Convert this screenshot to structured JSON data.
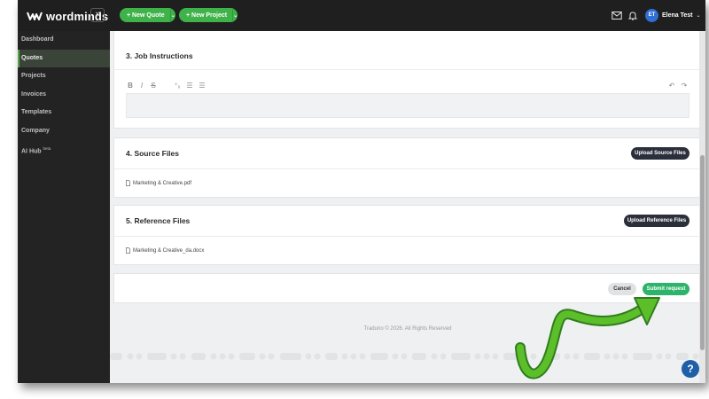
{
  "brand": {
    "name": "wordminds"
  },
  "topbar": {
    "collapse_symbol": "×",
    "new_quote": "+ New Quote",
    "new_project": "+ New Project",
    "caret": "⌄",
    "user_initials": "ET",
    "user_name": "Elena Test",
    "icons": [
      "mail-icon",
      "bell-icon"
    ]
  },
  "sidebar": {
    "items": [
      {
        "label": "Dashboard"
      },
      {
        "label": "Quotes",
        "active": true
      },
      {
        "label": "Projects"
      },
      {
        "label": "Invoices"
      },
      {
        "label": "Templates"
      },
      {
        "label": "Company"
      },
      {
        "label": "AI Hub",
        "badge": "beta"
      }
    ]
  },
  "sections": {
    "job_instructions": {
      "title": "3. Job Instructions",
      "toolbar": {
        "bold": "B",
        "italic": "I",
        "strike": "S",
        "clear": "⁺ₓ",
        "bullets": "☰",
        "numbered": "☰",
        "undo": "↶",
        "redo": "↷"
      }
    },
    "source_files": {
      "title": "4. Source Files",
      "upload_label": "Upload Source Files",
      "file": "Marketing & Creative.pdf"
    },
    "reference_files": {
      "title": "5. Reference Files",
      "upload_label": "Upload Reference Files",
      "file": "Marketing & Creative_da.docx"
    }
  },
  "actions": {
    "cancel": "Cancel",
    "submit": "Submit request"
  },
  "footer": {
    "text": "Traduno © 2026. All Rights Reserved"
  },
  "help": {
    "label": "?"
  },
  "colors": {
    "accent_green": "#3fb34a",
    "submit_green": "#2db36a",
    "dark_button": "#2a2f3b",
    "help_blue": "#1f5fa8",
    "annotation_arrow": "#4cae2c"
  }
}
